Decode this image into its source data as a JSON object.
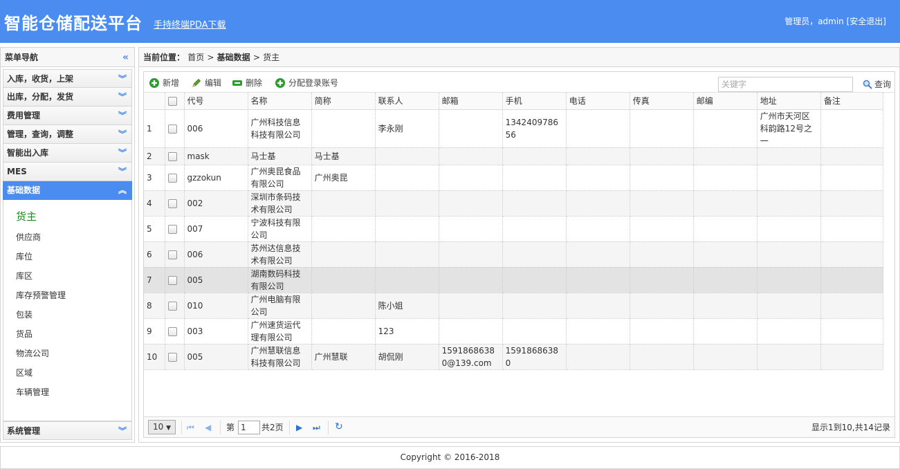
{
  "header": {
    "title": "智能仓储配送平台",
    "pda_link": "手持终端PDA下载",
    "user_text": "管理员，admin",
    "logout": "[安全退出]"
  },
  "sidebar": {
    "title": "菜单导航",
    "groups": [
      {
        "label": "入库，收货，上架"
      },
      {
        "label": "出库，分配，发货"
      },
      {
        "label": "费用管理"
      },
      {
        "label": "管理，查询，调整"
      },
      {
        "label": "智能出入库"
      },
      {
        "label": "MES"
      },
      {
        "label": "基础数据"
      }
    ],
    "sub_items": [
      {
        "label": "货主"
      },
      {
        "label": "供应商"
      },
      {
        "label": "库位"
      },
      {
        "label": "库区"
      },
      {
        "label": "库存预警管理"
      },
      {
        "label": "包装"
      },
      {
        "label": "货品"
      },
      {
        "label": "物流公司"
      },
      {
        "label": "区域"
      },
      {
        "label": "车辆管理"
      }
    ],
    "bottom_group": "系统管理"
  },
  "breadcrumb": {
    "prefix": "当前位置：",
    "home": "首页",
    "sep": ">",
    "section": "基础数据",
    "page": "货主"
  },
  "toolbar": {
    "add": "新增",
    "edit": "编辑",
    "delete": "删除",
    "assign": "分配登录账号",
    "search_placeholder": "关键字",
    "search_btn": "查询"
  },
  "table": {
    "columns": [
      "代号",
      "名称",
      "简称",
      "联系人",
      "邮箱",
      "手机",
      "电话",
      "传真",
      "邮编",
      "地址",
      "备注"
    ],
    "rows": [
      {
        "n": "1",
        "code": "006",
        "name": "广州科技信息科技有限公司",
        "short": "",
        "contact": "李永刚",
        "email": "",
        "mobile": "134240978656",
        "phone": "",
        "fax": "",
        "zip": "",
        "addr": "广州市天河区科韵路12号之一",
        "note": ""
      },
      {
        "n": "2",
        "code": "mask",
        "name": "马士基",
        "short": "马士基",
        "contact": "",
        "email": "",
        "mobile": "",
        "phone": "",
        "fax": "",
        "zip": "",
        "addr": "",
        "note": ""
      },
      {
        "n": "3",
        "code": "gzzokun",
        "name": "广州奥昆食品有限公司",
        "short": "广州奥昆",
        "contact": "",
        "email": "",
        "mobile": "",
        "phone": "",
        "fax": "",
        "zip": "",
        "addr": "",
        "note": ""
      },
      {
        "n": "4",
        "code": "002",
        "name": "深圳市条码技术有限公司",
        "short": "",
        "contact": "",
        "email": "",
        "mobile": "",
        "phone": "",
        "fax": "",
        "zip": "",
        "addr": "",
        "note": ""
      },
      {
        "n": "5",
        "code": "007",
        "name": "宁波科技有限公司",
        "short": "",
        "contact": "",
        "email": "",
        "mobile": "",
        "phone": "",
        "fax": "",
        "zip": "",
        "addr": "",
        "note": ""
      },
      {
        "n": "6",
        "code": "006",
        "name": "苏州达信息技术有限公司",
        "short": "",
        "contact": "",
        "email": "",
        "mobile": "",
        "phone": "",
        "fax": "",
        "zip": "",
        "addr": "",
        "note": ""
      },
      {
        "n": "7",
        "code": "005",
        "name": "湖南数码科技有限公司",
        "short": "",
        "contact": "",
        "email": "",
        "mobile": "",
        "phone": "",
        "fax": "",
        "zip": "",
        "addr": "",
        "note": ""
      },
      {
        "n": "8",
        "code": "010",
        "name": "广州电脑有限公司",
        "short": "",
        "contact": "陈小姐",
        "email": "",
        "mobile": "",
        "phone": "",
        "fax": "",
        "zip": "",
        "addr": "",
        "note": ""
      },
      {
        "n": "9",
        "code": "003",
        "name": "广州速货运代理有限公司",
        "short": "",
        "contact": "123",
        "email": "",
        "mobile": "",
        "phone": "",
        "fax": "",
        "zip": "",
        "addr": "",
        "note": ""
      },
      {
        "n": "10",
        "code": "005",
        "name": "广州慧联信息科技有限公司",
        "short": "广州慧联",
        "contact": "胡侃刚",
        "email": "15918686380@139.com",
        "mobile": "15918686380",
        "phone": "",
        "fax": "",
        "zip": "",
        "addr": "",
        "note": ""
      }
    ]
  },
  "pager": {
    "page_size": "10",
    "page_prefix": "第",
    "page_value": "1",
    "page_suffix": "共2页",
    "info": "显示1到10,共14记录"
  },
  "footer": {
    "copyright": "Copyright © 2016-2018"
  },
  "colors": {
    "brand": "#4a8cf0",
    "active_sub": "#1a8a1a"
  }
}
